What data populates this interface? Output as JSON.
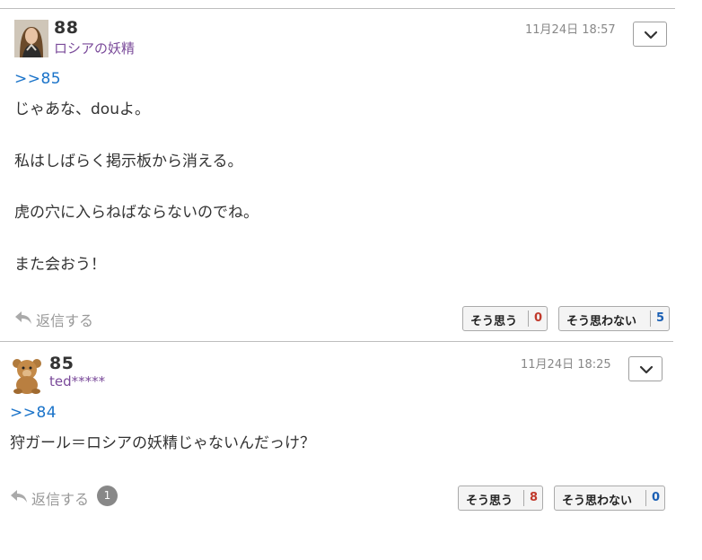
{
  "posts": [
    {
      "number": "88",
      "username": "ロシアの妖精",
      "date": "11月24日 18:57",
      "anchor": ">>85",
      "lines": [
        "じゃあな、douよ。",
        "私はしばらく掲示板から消える。",
        "虎の穴に入らねばならないのでね。",
        "また会おう！"
      ],
      "reply_label": "返信する",
      "agree_label": "そう思う",
      "agree_count": "0",
      "disagree_label": "そう思わない",
      "disagree_count": "5"
    },
    {
      "number": "85",
      "username": "ted*****",
      "date": "11月24日 18:25",
      "anchor": ">>84",
      "lines": [
        "狩ガール＝ロシアの妖精じゃないんだっけ？"
      ],
      "reply_label": "返信する",
      "reply_count": "1",
      "agree_label": "そう思う",
      "agree_count": "8",
      "disagree_label": "そう思わない",
      "disagree_count": "0"
    }
  ],
  "colors": {
    "anchor": "#1a73c9",
    "username": "#7a4a9a",
    "agree_count": "#c0392b",
    "disagree_count": "#1a5fb4"
  },
  "icons": {
    "avatar_1": "woman-portrait-avatar",
    "avatar_2": "teddy-bear-avatar",
    "menu": "chevron-down-icon",
    "reply": "reply-arrow-icon"
  }
}
